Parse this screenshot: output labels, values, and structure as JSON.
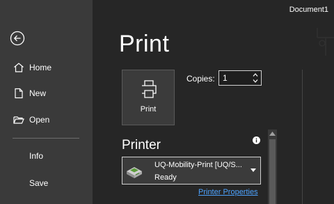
{
  "window": {
    "document_title": "Document1"
  },
  "sidebar": {
    "back_icon": "arrow-left-circle-icon",
    "items": [
      {
        "label": "Home",
        "icon": "home-icon"
      },
      {
        "label": "New",
        "icon": "new-document-icon"
      },
      {
        "label": "Open",
        "icon": "open-folder-icon"
      },
      {
        "label": "Info"
      },
      {
        "label": "Save"
      }
    ]
  },
  "main": {
    "title": "Print",
    "print_button": {
      "label": "Print",
      "icon": "printer-icon"
    },
    "copies": {
      "label": "Copies:",
      "value": "1"
    },
    "printer": {
      "heading": "Printer",
      "info_icon": "info-icon",
      "name": "UQ-Mobility-Print [UQ/S...",
      "status": "Ready",
      "properties_link": "Printer Properties"
    }
  },
  "colors": {
    "sidebar_bg": "#3a3a3a",
    "main_bg": "#262626",
    "link": "#4da3ff",
    "text": "#ffffff"
  }
}
